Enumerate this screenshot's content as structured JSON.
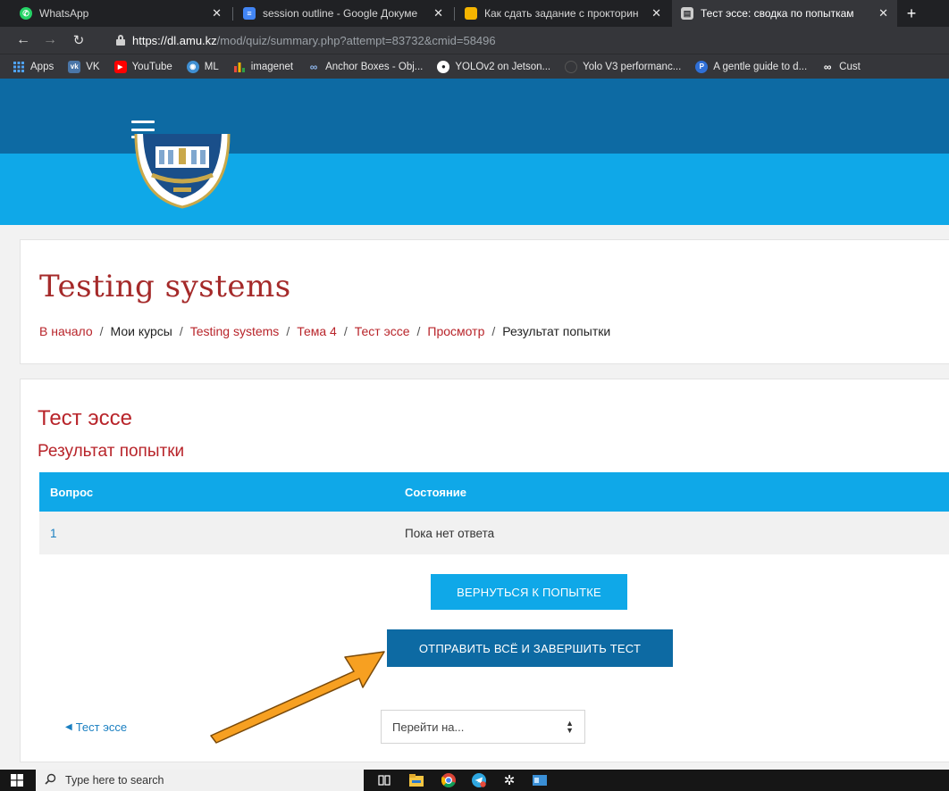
{
  "browser": {
    "tabs": [
      {
        "title": "WhatsApp",
        "icon": "whatsapp-icon",
        "color": "#25d366",
        "active": false
      },
      {
        "title": "session outline - Google Докуме",
        "icon": "google-docs-icon",
        "color": "#4285f4",
        "active": false
      },
      {
        "title": "Как сдать задание с прокторин",
        "icon": "google-slides-icon",
        "color": "#f4b400",
        "active": false
      },
      {
        "title": "Тест эссе: сводка по попыткам",
        "icon": "moodle-page-icon",
        "color": "#cccccc",
        "active": true
      }
    ],
    "tab_close_glyph": "✕",
    "new_tab_glyph": "+",
    "url": {
      "scheme": "https://",
      "host": "dl.amu.kz",
      "path": "/mod/quiz/summary.php?attempt=83732&cmid=58496"
    },
    "bookmarks": [
      {
        "label": "Apps",
        "icon": "apps-grid-icon",
        "color": "#4285f4"
      },
      {
        "label": "VK",
        "icon": "vk-icon",
        "color": "#4a76a8"
      },
      {
        "label": "YouTube",
        "icon": "youtube-icon",
        "color": "#ff0000"
      },
      {
        "label": "ML",
        "icon": "ml-icon",
        "color": "#3f8fd2"
      },
      {
        "label": "imagenet",
        "icon": "imagenet-icon",
        "color": "#2e9e44"
      },
      {
        "label": "Anchor Boxes - Obj...",
        "icon": "infinity-icon",
        "color": "#5b8fd6"
      },
      {
        "label": "YOLOv2 on Jetson...",
        "icon": "github-icon",
        "color": "#ffffff"
      },
      {
        "label": "Yolo V3 performanc...",
        "icon": "blank-page-icon",
        "color": "#35363a"
      },
      {
        "label": "A gentle guide to d...",
        "icon": "pinterest-p-icon",
        "color": "#2f6fd6"
      },
      {
        "label": "Cust",
        "icon": "infinity-icon",
        "color": "#ffffff"
      }
    ]
  },
  "site": {
    "navbar_color": "#0d6aa3",
    "banner_color": "#0fa8e8"
  },
  "page": {
    "course_title": "Testing systems",
    "breadcrumb": [
      {
        "label": "В начало",
        "link": true
      },
      {
        "label": "Мои курсы",
        "link": false
      },
      {
        "label": "Testing systems",
        "link": true
      },
      {
        "label": "Тема 4",
        "link": true
      },
      {
        "label": "Тест эссе",
        "link": true
      },
      {
        "label": "Просмотр",
        "link": true
      },
      {
        "label": "Результат попытки",
        "link": false
      }
    ],
    "breadcrumb_sep": "/"
  },
  "main": {
    "quiz_title": "Тест эссе",
    "summary_title": "Результат попытки",
    "table": {
      "headers": [
        "Вопрос",
        "Состояние"
      ],
      "rows": [
        {
          "question": "1",
          "status": "Пока нет ответа"
        }
      ]
    },
    "return_button": "ВЕРНУТЬСЯ К ПОПЫТКЕ",
    "submit_button": "ОТПРАВИТЬ ВСЁ И ЗАВЕРШИТЬ ТЕСТ",
    "prev_link": "Тест эссе",
    "jump_select": "Перейти на..."
  },
  "annotation": {
    "arrow_color": "#f7a021"
  },
  "taskbar": {
    "search_placeholder": "Type here to search",
    "apps": [
      {
        "icon": "task-view-icon"
      },
      {
        "icon": "file-explorer-icon"
      },
      {
        "icon": "chrome-icon"
      },
      {
        "icon": "telegram-icon"
      },
      {
        "icon": "settings-gear-icon"
      },
      {
        "icon": "app-window-icon"
      }
    ]
  }
}
